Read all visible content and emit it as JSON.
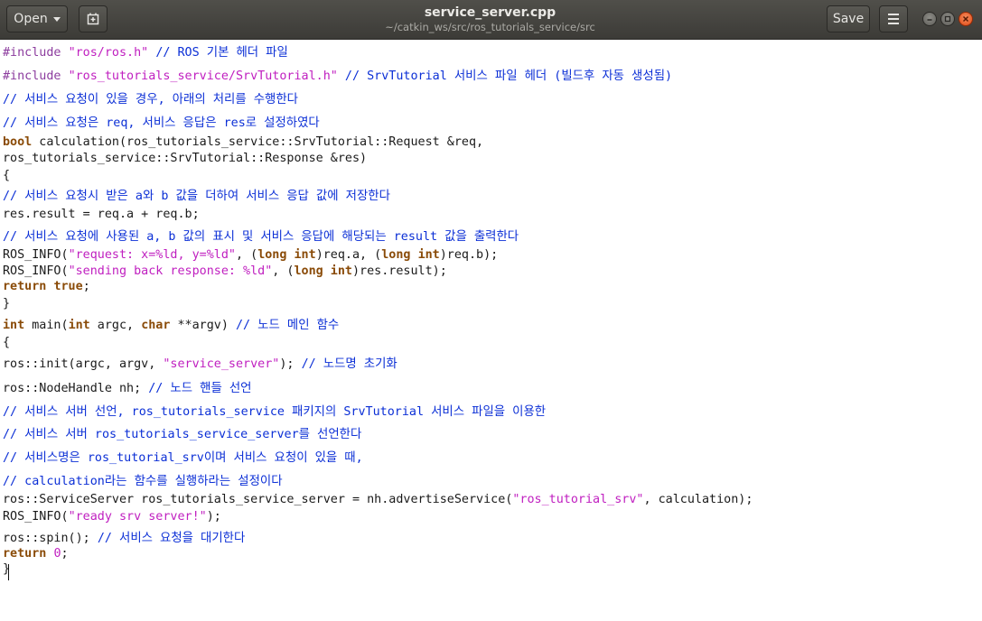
{
  "window": {
    "title": "service_server.cpp",
    "subtitle": "~/catkin_ws/src/ros_tutorials_service/src",
    "open_label": "Open",
    "save_label": "Save",
    "icons": [
      "document-pin-icon",
      "hamburger-menu-icon",
      "minimize-icon",
      "maximize-icon",
      "close-icon"
    ]
  },
  "code": {
    "colors": {
      "keyword": "#8a4b08",
      "preprocessor": "#8c3c9e",
      "string": "#c020c0",
      "comment": "#0b2fd6",
      "text": "#1a1a1a"
    },
    "lines": [
      [
        {
          "t": "pre",
          "s": "#include "
        },
        {
          "t": "str",
          "s": "\"ros/ros.h\""
        },
        {
          "t": "",
          "s": " "
        },
        {
          "t": "cm",
          "s": "// ROS 기본 헤더 파일"
        }
      ],
      [
        {
          "t": "pre",
          "s": "#include "
        },
        {
          "t": "str",
          "s": "\"ros_tutorials_service/SrvTutorial.h\""
        },
        {
          "t": "",
          "s": " "
        },
        {
          "t": "cm",
          "s": "// SrvTutorial 서비스 파일 헤더 (빌드후 자동 생성됨)"
        }
      ],
      [
        {
          "t": "cm",
          "s": "// 서비스 요청이 있을 경우, 아래의 처리를 수행한다"
        }
      ],
      [
        {
          "t": "cm",
          "s": "// 서비스 요청은 req, 서비스 응답은 res로 설정하였다"
        }
      ],
      [
        {
          "t": "kw",
          "s": "bool"
        },
        {
          "t": "",
          "s": " calculation(ros_tutorials_service::SrvTutorial::Request &req,"
        }
      ],
      [
        {
          "t": "",
          "s": "ros_tutorials_service::SrvTutorial::Response &res)"
        }
      ],
      [
        {
          "t": "",
          "s": "{"
        }
      ],
      [
        {
          "t": "cm",
          "s": "// 서비스 요청시 받은 a와 b 값을 더하여 서비스 응답 값에 저장한다"
        }
      ],
      [
        {
          "t": "",
          "s": "res.result = req.a + req.b;"
        }
      ],
      [
        {
          "t": "cm",
          "s": "// 서비스 요청에 사용된 a, b 값의 표시 및 서비스 응답에 해당되는 result 값을 출력한다"
        }
      ],
      [
        {
          "t": "",
          "s": "ROS_INFO("
        },
        {
          "t": "str",
          "s": "\"request: x=%ld, y=%ld\""
        },
        {
          "t": "",
          "s": ", ("
        },
        {
          "t": "kw",
          "s": "long"
        },
        {
          "t": "",
          "s": " "
        },
        {
          "t": "kw",
          "s": "int"
        },
        {
          "t": "",
          "s": ")req.a, ("
        },
        {
          "t": "kw",
          "s": "long"
        },
        {
          "t": "",
          "s": " "
        },
        {
          "t": "kw",
          "s": "int"
        },
        {
          "t": "",
          "s": ")req.b);"
        }
      ],
      [
        {
          "t": "",
          "s": "ROS_INFO("
        },
        {
          "t": "str",
          "s": "\"sending back response: %ld\""
        },
        {
          "t": "",
          "s": ", ("
        },
        {
          "t": "kw",
          "s": "long"
        },
        {
          "t": "",
          "s": " "
        },
        {
          "t": "kw",
          "s": "int"
        },
        {
          "t": "",
          "s": ")res.result);"
        }
      ],
      [
        {
          "t": "kw",
          "s": "return"
        },
        {
          "t": "",
          "s": " "
        },
        {
          "t": "kw",
          "s": "true"
        },
        {
          "t": "",
          "s": ";"
        }
      ],
      [
        {
          "t": "",
          "s": "}"
        }
      ],
      [
        {
          "t": "kw",
          "s": "int"
        },
        {
          "t": "",
          "s": " main("
        },
        {
          "t": "kw",
          "s": "int"
        },
        {
          "t": "",
          "s": " argc, "
        },
        {
          "t": "kw",
          "s": "char"
        },
        {
          "t": "",
          "s": " **argv) "
        },
        {
          "t": "cm",
          "s": "// 노드 메인 함수"
        }
      ],
      [
        {
          "t": "",
          "s": "{"
        }
      ],
      [
        {
          "t": "",
          "s": "ros::init(argc, argv, "
        },
        {
          "t": "str",
          "s": "\"service_server\""
        },
        {
          "t": "",
          "s": "); "
        },
        {
          "t": "cm",
          "s": "// 노드명 초기화"
        }
      ],
      [
        {
          "t": "",
          "s": "ros::NodeHandle nh; "
        },
        {
          "t": "cm",
          "s": "// 노드 핸들 선언"
        }
      ],
      [
        {
          "t": "cm",
          "s": "// 서비스 서버 선언, ros_tutorials_service 패키지의 SrvTutorial 서비스 파일을 이용한"
        }
      ],
      [
        {
          "t": "cm",
          "s": "// 서비스 서버 ros_tutorials_service_server를 선언한다"
        }
      ],
      [
        {
          "t": "cm",
          "s": "// 서비스명은 ros_tutorial_srv이며 서비스 요청이 있을 때,"
        }
      ],
      [
        {
          "t": "cm",
          "s": "// calculation라는 함수를 실행하라는 설정이다"
        }
      ],
      [
        {
          "t": "",
          "s": "ros::ServiceServer ros_tutorials_service_server = nh.advertiseService("
        },
        {
          "t": "str",
          "s": "\"ros_tutorial_srv\""
        },
        {
          "t": "",
          "s": ", calculation);"
        }
      ],
      [
        {
          "t": "",
          "s": "ROS_INFO("
        },
        {
          "t": "str",
          "s": "\"ready srv server!\""
        },
        {
          "t": "",
          "s": ");"
        }
      ],
      [
        {
          "t": "",
          "s": "ros::spin(); "
        },
        {
          "t": "cm",
          "s": "// 서비스 요청을 대기한다"
        }
      ],
      [
        {
          "t": "kw",
          "s": "return"
        },
        {
          "t": "",
          "s": " "
        },
        {
          "t": "num",
          "s": "0"
        },
        {
          "t": "",
          "s": ";"
        }
      ],
      [
        {
          "t": "",
          "s": "}"
        }
      ]
    ]
  }
}
